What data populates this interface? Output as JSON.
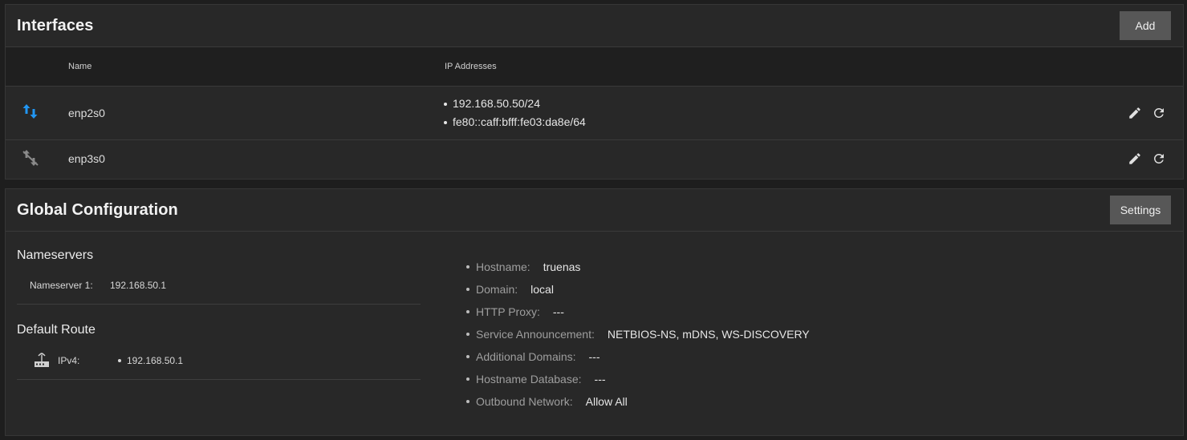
{
  "interfaces": {
    "title": "Interfaces",
    "add_label": "Add",
    "columns": {
      "name": "Name",
      "ip": "IP Addresses"
    },
    "rows": [
      {
        "name": "enp2s0",
        "status": "link-up",
        "status_color": "#2196f3",
        "ips": [
          "192.168.50.50/24",
          "fe80::caff:bfff:fe03:da8e/64"
        ]
      },
      {
        "name": "enp3s0",
        "status": "link-down",
        "status_color": "#8a8a8a",
        "ips": []
      }
    ]
  },
  "global": {
    "title": "Global Configuration",
    "settings_label": "Settings",
    "nameservers": {
      "title": "Nameservers",
      "items": [
        {
          "label": "Nameserver 1:",
          "value": "192.168.50.1"
        }
      ]
    },
    "default_route": {
      "title": "Default Route",
      "icon": "router-icon",
      "label": "IPv4:",
      "values": [
        "192.168.50.1"
      ]
    },
    "config": [
      {
        "label": "Hostname:",
        "value": "truenas"
      },
      {
        "label": "Domain:",
        "value": "local"
      },
      {
        "label": "HTTP Proxy:",
        "value": "---"
      },
      {
        "label": "Service Announcement:",
        "value": "NETBIOS-NS, mDNS, WS-DISCOVERY"
      },
      {
        "label": "Additional Domains:",
        "value": "---"
      },
      {
        "label": "Hostname Database:",
        "value": "---"
      },
      {
        "label": "Outbound Network:",
        "value": "Allow All"
      }
    ]
  },
  "colors": {
    "accent": "#2196f3",
    "card_bg": "#282828",
    "page_bg": "#1e1e1e",
    "button_bg": "#575757"
  }
}
